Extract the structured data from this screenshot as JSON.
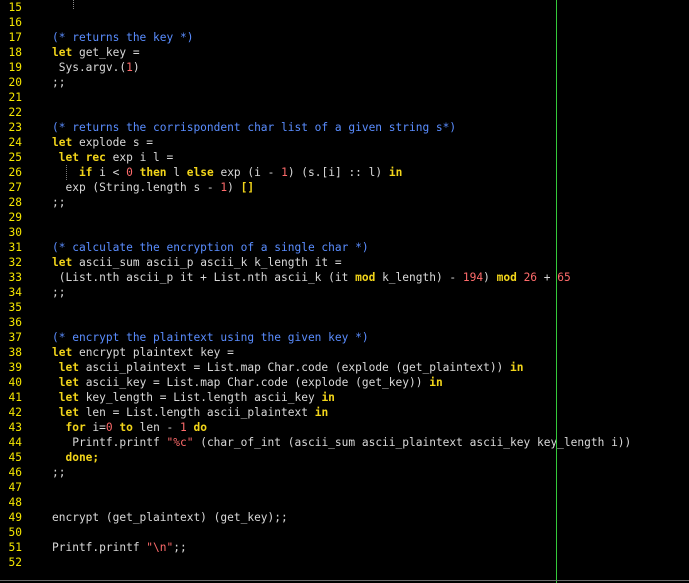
{
  "editor": {
    "colors": {
      "background": "#000000",
      "line_number": "#f5e600",
      "keyword": "#f2d51a",
      "comment": "#5a8dff",
      "number": "#ff6b6b",
      "default_text": "#d9d9d9",
      "margin_line": "#34c93a"
    },
    "lines": [
      {
        "number": "15",
        "tokens": []
      },
      {
        "number": "16",
        "tokens": []
      },
      {
        "number": "17",
        "tokens": [
          {
            "t": "(* returns the key *)",
            "c": "cm"
          }
        ]
      },
      {
        "number": "18",
        "tokens": [
          {
            "t": "let",
            "c": "kw"
          },
          {
            "t": " get_key =",
            "c": "op"
          }
        ]
      },
      {
        "number": "19",
        "tokens": [
          {
            "t": " Sys.argv.(",
            "c": "op"
          },
          {
            "t": "1",
            "c": "num"
          },
          {
            "t": ")",
            "c": "op"
          }
        ]
      },
      {
        "number": "20",
        "tokens": [
          {
            "t": ";;",
            "c": "op"
          }
        ]
      },
      {
        "number": "21",
        "tokens": []
      },
      {
        "number": "22",
        "tokens": []
      },
      {
        "number": "23",
        "tokens": [
          {
            "t": "(* returns the corrispondent char list of a given string s*)",
            "c": "cm"
          }
        ]
      },
      {
        "number": "24",
        "tokens": [
          {
            "t": "let",
            "c": "kw"
          },
          {
            "t": " explode s =",
            "c": "op"
          }
        ]
      },
      {
        "number": "25",
        "tokens": [
          {
            "t": " let rec",
            "c": "kw"
          },
          {
            "t": " exp i l =",
            "c": "op"
          }
        ]
      },
      {
        "number": "26",
        "tokens": [
          {
            "t": "    if",
            "c": "kw"
          },
          {
            "t": " i < ",
            "c": "op"
          },
          {
            "t": "0",
            "c": "num"
          },
          {
            "t": " then",
            "c": "kw"
          },
          {
            "t": " l ",
            "c": "op"
          },
          {
            "t": "else",
            "c": "kw"
          },
          {
            "t": " exp (i - ",
            "c": "op"
          },
          {
            "t": "1",
            "c": "num"
          },
          {
            "t": ") (s.[i] :: l) ",
            "c": "op"
          },
          {
            "t": "in",
            "c": "kw"
          }
        ]
      },
      {
        "number": "27",
        "tokens": [
          {
            "t": "  exp (String.length s - ",
            "c": "op"
          },
          {
            "t": "1",
            "c": "num"
          },
          {
            "t": ") ",
            "c": "op"
          },
          {
            "t": "[]",
            "c": "kw"
          }
        ]
      },
      {
        "number": "28",
        "tokens": [
          {
            "t": ";;",
            "c": "op"
          }
        ]
      },
      {
        "number": "29",
        "tokens": []
      },
      {
        "number": "30",
        "tokens": []
      },
      {
        "number": "31",
        "tokens": [
          {
            "t": "(* calculate the encryption of a single char *)",
            "c": "cm"
          }
        ]
      },
      {
        "number": "32",
        "tokens": [
          {
            "t": "let",
            "c": "kw"
          },
          {
            "t": " ascii_sum ascii_p ascii_k k_length it =",
            "c": "op"
          }
        ]
      },
      {
        "number": "33",
        "tokens": [
          {
            "t": " (List.nth ascii_p it + List.nth ascii_k (it ",
            "c": "op"
          },
          {
            "t": "mod",
            "c": "kw"
          },
          {
            "t": " k_length) - ",
            "c": "op"
          },
          {
            "t": "194",
            "c": "num"
          },
          {
            "t": ") ",
            "c": "op"
          },
          {
            "t": "mod",
            "c": "kw"
          },
          {
            "t": " ",
            "c": "op"
          },
          {
            "t": "26",
            "c": "num"
          },
          {
            "t": " + ",
            "c": "op"
          },
          {
            "t": "65",
            "c": "num"
          }
        ]
      },
      {
        "number": "34",
        "tokens": [
          {
            "t": ";;",
            "c": "op"
          }
        ]
      },
      {
        "number": "35",
        "tokens": []
      },
      {
        "number": "36",
        "tokens": []
      },
      {
        "number": "37",
        "tokens": [
          {
            "t": "(* encrypt the plaintext using the given key *)",
            "c": "cm"
          }
        ]
      },
      {
        "number": "38",
        "tokens": [
          {
            "t": "let",
            "c": "kw"
          },
          {
            "t": " encrypt plaintext key =",
            "c": "op"
          }
        ]
      },
      {
        "number": "39",
        "tokens": [
          {
            "t": " let",
            "c": "kw"
          },
          {
            "t": " ascii_plaintext = List.map Char.code (explode (get_plaintext)) ",
            "c": "op"
          },
          {
            "t": "in",
            "c": "kw"
          }
        ]
      },
      {
        "number": "40",
        "tokens": [
          {
            "t": " let",
            "c": "kw"
          },
          {
            "t": " ascii_key = List.map Char.code (explode (get_key)) ",
            "c": "op"
          },
          {
            "t": "in",
            "c": "kw"
          }
        ]
      },
      {
        "number": "41",
        "tokens": [
          {
            "t": " let",
            "c": "kw"
          },
          {
            "t": " key_length = List.length ascii_key ",
            "c": "op"
          },
          {
            "t": "in",
            "c": "kw"
          }
        ]
      },
      {
        "number": "42",
        "tokens": [
          {
            "t": " let",
            "c": "kw"
          },
          {
            "t": " len = List.length ascii_plaintext ",
            "c": "op"
          },
          {
            "t": "in",
            "c": "kw"
          }
        ]
      },
      {
        "number": "43",
        "tokens": [
          {
            "t": "  for",
            "c": "kw"
          },
          {
            "t": " i=",
            "c": "op"
          },
          {
            "t": "0",
            "c": "num"
          },
          {
            "t": " to",
            "c": "kw"
          },
          {
            "t": " len - ",
            "c": "op"
          },
          {
            "t": "1",
            "c": "num"
          },
          {
            "t": " do",
            "c": "kw"
          }
        ]
      },
      {
        "number": "44",
        "tokens": [
          {
            "t": "   Printf.printf ",
            "c": "op"
          },
          {
            "t": "\"%c\"",
            "c": "str"
          },
          {
            "t": " (char_of_int (ascii_sum ascii_plaintext ascii_key key_length i))",
            "c": "op"
          }
        ]
      },
      {
        "number": "45",
        "tokens": [
          {
            "t": "  done;",
            "c": "kw"
          }
        ]
      },
      {
        "number": "46",
        "tokens": [
          {
            "t": ";;",
            "c": "op"
          }
        ]
      },
      {
        "number": "47",
        "tokens": []
      },
      {
        "number": "48",
        "tokens": []
      },
      {
        "number": "49",
        "tokens": [
          {
            "t": "encrypt (get_plaintext) (get_key);;",
            "c": "op"
          }
        ]
      },
      {
        "number": "50",
        "tokens": []
      },
      {
        "number": "51",
        "tokens": [
          {
            "t": "Printf.printf ",
            "c": "op"
          },
          {
            "t": "\"\\n\"",
            "c": "str"
          },
          {
            "t": ";;",
            "c": "op"
          }
        ]
      },
      {
        "number": "52",
        "tokens": []
      }
    ]
  }
}
